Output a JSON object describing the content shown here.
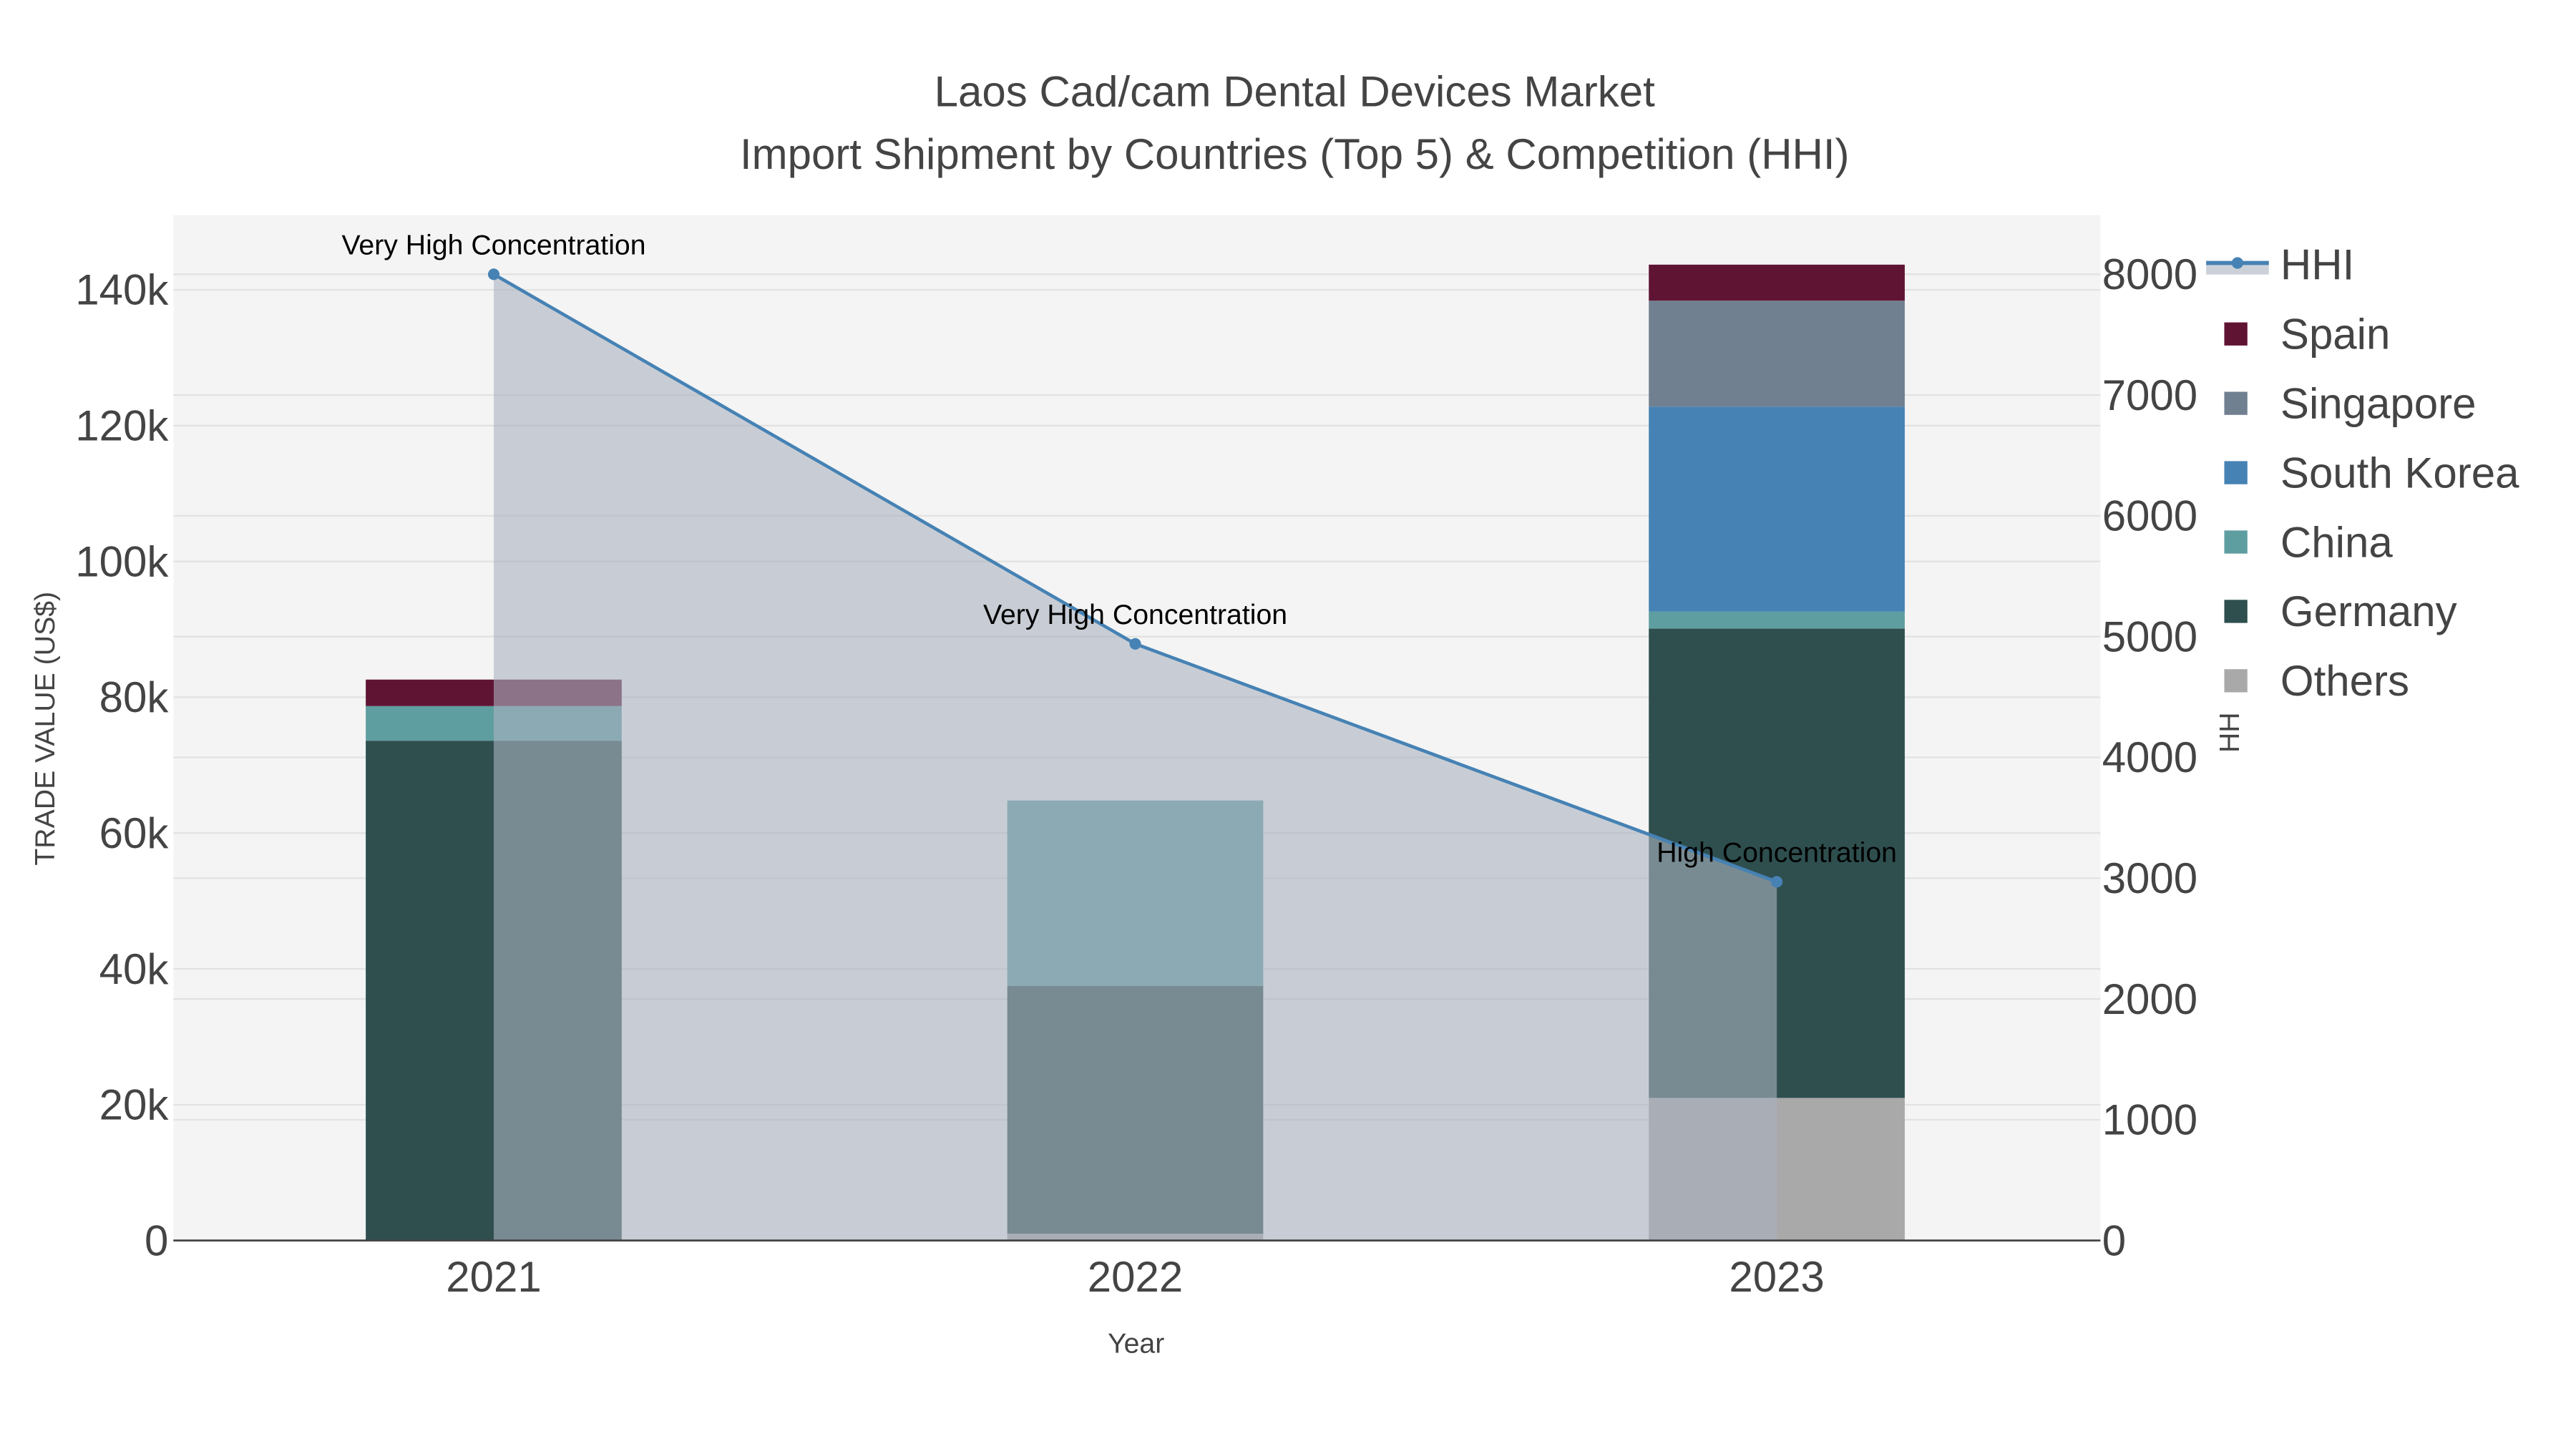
{
  "chart_data": {
    "type": "bar",
    "barmode": "stack",
    "title": "Laos Cad/cam Dental Devices Market",
    "subtitle": "Import Shipment by Countries (Top 5) & Competition (HHI)",
    "xlabel": "Year",
    "ylabel": "TRADE VALUE (US$)",
    "y2label": "HHI",
    "categories": [
      "2021",
      "2022",
      "2023"
    ],
    "ylim": [
      0,
      151000
    ],
    "y2lim": [
      0,
      8490
    ],
    "yticks": [
      0,
      20000,
      40000,
      60000,
      80000,
      100000,
      120000,
      140000
    ],
    "ytick_labels": [
      "0",
      "20k",
      "40k",
      "60k",
      "80k",
      "100k",
      "120k",
      "140k"
    ],
    "y2ticks": [
      0,
      1000,
      2000,
      3000,
      4000,
      5000,
      6000,
      7000,
      8000
    ],
    "y2tick_labels": [
      "0",
      "1000",
      "2000",
      "3000",
      "4000",
      "5000",
      "6000",
      "7000",
      "8000"
    ],
    "series": [
      {
        "name": "Others",
        "color": "#a9a9a9",
        "values": [
          0,
          1000,
          21000
        ]
      },
      {
        "name": "Germany",
        "color": "#2f4f4f",
        "values": [
          73600,
          36500,
          69100
        ]
      },
      {
        "name": "China",
        "color": "#5f9ea0",
        "values": [
          5100,
          27300,
          2500
        ]
      },
      {
        "name": "South Korea",
        "color": "#4682b4",
        "values": [
          0,
          0,
          30200
        ]
      },
      {
        "name": "Singapore",
        "color": "#708090",
        "values": [
          0,
          0,
          15600
        ]
      },
      {
        "name": "Spain",
        "color": "#601434",
        "values": [
          3900,
          0,
          5300
        ]
      }
    ],
    "line": {
      "name": "HHI",
      "color": "#4682b4",
      "fill": "rgba(170,178,192,0.6)",
      "values": [
        8000,
        4940,
        2970
      ],
      "annotations": [
        "Very High Concentration",
        "Very High Concentration",
        "High Concentration"
      ]
    },
    "legend_order": [
      "HHI",
      "Spain",
      "Singapore",
      "South Korea",
      "China",
      "Germany",
      "Others"
    ],
    "legend_position": "right",
    "grid": true
  }
}
